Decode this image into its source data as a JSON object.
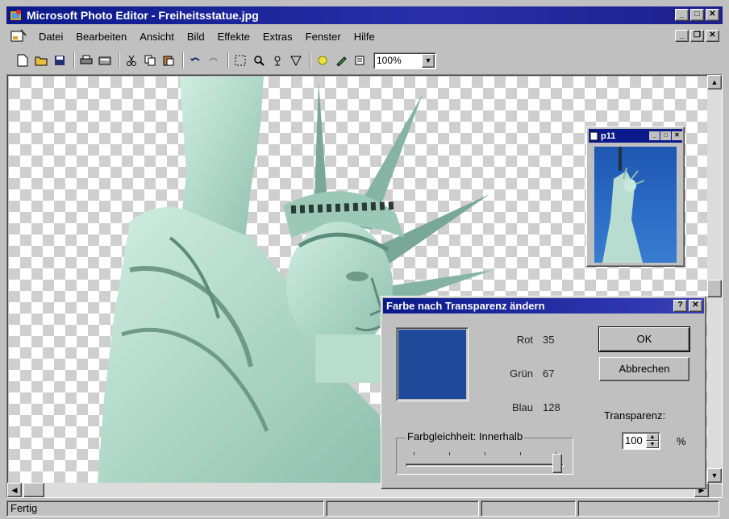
{
  "window": {
    "title": "Microsoft Photo Editor - Freiheitsstatue.jpg",
    "controls": {
      "minimize": "_",
      "maximize": "□",
      "close": "✕"
    }
  },
  "menu": {
    "items": [
      "Datei",
      "Bearbeiten",
      "Ansicht",
      "Bild",
      "Effekte",
      "Extras",
      "Fenster",
      "Hilfe"
    ],
    "controls": {
      "minimize": "_",
      "restore": "❐",
      "close": "✕"
    }
  },
  "toolbar": {
    "icons": [
      "new-icon",
      "open-icon",
      "save-icon",
      "print-icon",
      "scan-icon",
      "cut-icon",
      "copy-icon",
      "paste-icon",
      "undo-icon",
      "redo-icon",
      "select-icon",
      "zoom-icon",
      "smudge-icon",
      "transparency-icon",
      "color-icon",
      "pen-icon",
      "properties-icon"
    ],
    "zoom": "100%"
  },
  "thumbnail": {
    "title": "p11",
    "controls": {
      "minimize": "_",
      "maximize": "□",
      "close": "✕"
    }
  },
  "dialog": {
    "title": "Farbe nach Transparenz ändern",
    "help": "?",
    "close": "✕",
    "swatch_color": "#1f4a9a",
    "rgb": [
      {
        "label": "Rot",
        "value": "35"
      },
      {
        "label": "Grün",
        "value": "67"
      },
      {
        "label": "Blau",
        "value": "128"
      }
    ],
    "ok": "OK",
    "cancel": "Abbrechen",
    "transparency_label": "Transparenz:",
    "transparency_value": "100",
    "transparency_unit": "%",
    "tolerance_label": "Farbgleichheit: Innerhalb"
  },
  "status": {
    "text": "Fertig"
  },
  "colors": {
    "titlebar": "#0a1a8a",
    "face": "#c0c0c0",
    "statue": "#a9d4c4"
  }
}
